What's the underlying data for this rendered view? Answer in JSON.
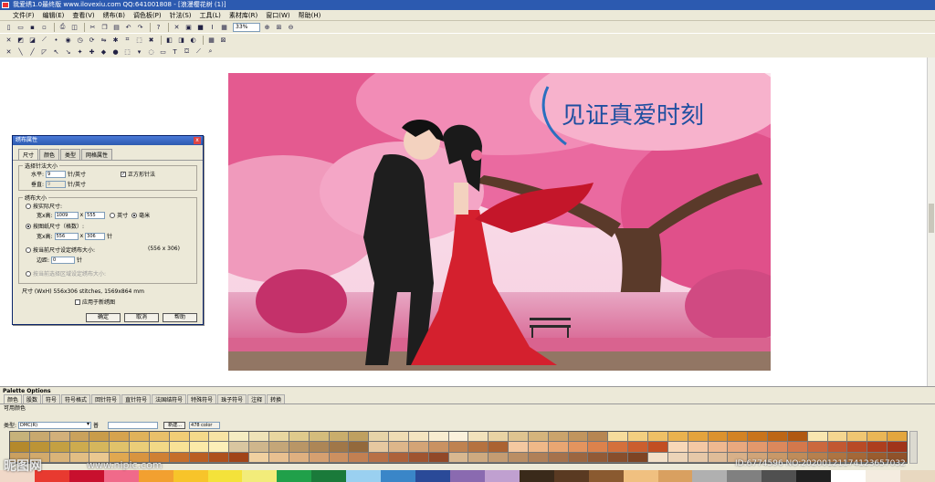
{
  "window_title": "我爱绣1.0最终版 www.ilovexiu.com QQ:641001808 - [浪漫樱花树 (1)]",
  "menu": [
    "文件(F)",
    "编辑(E)",
    "查看(V)",
    "绣布(B)",
    "调色板(P)",
    "针法(S)",
    "工具(L)",
    "素材库(R)",
    "窗口(W)",
    "帮助(H)"
  ],
  "toolbar": {
    "zoom_value": "33%"
  },
  "picture": {
    "title_text": "见证真爱时刻"
  },
  "dialog": {
    "title": "绣布属性",
    "close": "x",
    "tabs": [
      "尺寸",
      "颜色",
      "类型",
      "网格属性"
    ],
    "group_stitch": {
      "label": "选择针法大小",
      "horizontal_label": "水平:",
      "horizontal_value": "9",
      "horizontal_unit": "针/英寸",
      "square_label": "正方形针法",
      "square_checked": "✓",
      "vertical_label": "垂直:",
      "vertical_value": "9",
      "vertical_unit": "针/英寸"
    },
    "group_size": {
      "label": "绣布大小",
      "opt_actual": "按实际尺寸:",
      "wh_label": "宽x高:",
      "actual_w": "1009",
      "x_sep": "x",
      "actual_h": "555",
      "unit_inch": "英寸",
      "unit_mm": "毫米",
      "opt_pattern": "按图纸尺寸（格数）:",
      "pattern_w": "556",
      "pattern_h": "306",
      "pattern_unit": "针",
      "opt_current": "按当前尺寸设定绣布大小:",
      "current_dims": "(556 x 306)",
      "margin_label": "边距:",
      "margin_value": "0",
      "margin_unit": "针",
      "opt_selection": "按当前选择区域设定绣布大小:"
    },
    "size_line": "尺寸 (WxH) 556x306 stitches,  1569x864 mm",
    "apply_new": "应用于新绣图",
    "ok": "确定",
    "cancel": "取消",
    "help": "帮助"
  },
  "palette": {
    "title": "Palette Options",
    "tabs": [
      "颜色",
      "股数",
      "符号",
      "符号格式",
      "回针符号",
      "直针符号",
      "法国结符号",
      "特殊符号",
      "珠子符号",
      "注释",
      "转换"
    ],
    "sub": "可用颜色",
    "type_label": "类型:",
    "type_value": "DMC(R)",
    "extra": "普",
    "new_btn": "新建...",
    "count": "478 color",
    "swatches": [
      "#c6b27a",
      "#c9a96e",
      "#d2b07a",
      "#caa25c",
      "#c99c4a",
      "#d6a34e",
      "#e0b25a",
      "#e9c06a",
      "#f1cd76",
      "#f4d98a",
      "#f7e3a4",
      "#f5ecc2",
      "#efe3b8",
      "#e8d6a0",
      "#dfca8c",
      "#d4bc7c",
      "#c9ad6c",
      "#bfa060",
      "#e6d3a8",
      "#efdcb4",
      "#f4e4c0",
      "#f8ecd0",
      "#fbf1dc",
      "#f2e2bc",
      "#e9d3a4",
      "#dfc490",
      "#d5b47c",
      "#cba46c",
      "#c1955e",
      "#b78652",
      "#f6dc9c",
      "#f3cf80",
      "#efc066",
      "#eab24e",
      "#e4a33c",
      "#dc922e",
      "#d38324",
      "#c9741c",
      "#bd6616",
      "#b05812",
      "#f9e6b0",
      "#f5d690",
      "#f0c672",
      "#eab656",
      "#e3a63e",
      "#b4892c",
      "#bc9436",
      "#c4a042",
      "#cdab4e",
      "#d5b65c",
      "#e0c26a",
      "#eacd78",
      "#f2d886",
      "#f8e296",
      "#fbeaa8",
      "#fcefb8",
      "#d9c6a0",
      "#cfb68c",
      "#c4a678",
      "#b99666",
      "#ad8656",
      "#a07748",
      "#93693c",
      "#e6c8a0",
      "#ddb68a",
      "#d3a476",
      "#c99262",
      "#bf8250",
      "#b57240",
      "#ab6232",
      "#f4c8a0",
      "#efb888",
      "#e9a672",
      "#e3945e",
      "#dc824c",
      "#d4703c",
      "#cb5e2e",
      "#c24e22",
      "#f8d8b8",
      "#f4c8a4",
      "#efb890",
      "#e9a87e",
      "#e3986c",
      "#dc885c",
      "#d4784c",
      "#cb683e",
      "#c25832",
      "#b84a26",
      "#ad3e1e",
      "#a0341a",
      "#caa060",
      "#d2aa6c",
      "#dab478",
      "#e2be84",
      "#eac890",
      "#e0a850",
      "#d89440",
      "#cf8034",
      "#c56e2a",
      "#ba5e22",
      "#ae501c",
      "#a14418",
      "#f0d0a0",
      "#e8c090",
      "#dfb080",
      "#d6a070",
      "#cc9060",
      "#c28052",
      "#b87046",
      "#ad623a",
      "#9f5430",
      "#914828",
      "#d8b890",
      "#ceaa80",
      "#c49c72",
      "#ba8e64",
      "#b08058",
      "#a6724c",
      "#9c6640",
      "#925a36",
      "#884e2c",
      "#7e4424",
      "#f2e0c8",
      "#ecd4b8",
      "#e6c8a8",
      "#dfbc98",
      "#d8b088",
      "#d0a478",
      "#c89868",
      "#bf8c5a",
      "#b6804e",
      "#ad7442",
      "#a46838",
      "#9a5c2e",
      "#90522a",
      "#864826",
      "#7c4022"
    ],
    "bottom_strip": [
      "#f0d8c8",
      "#e83a30",
      "#c8102e",
      "#f06a8a",
      "#f2a030",
      "#f7c42a",
      "#f4e23a",
      "#f2ec7a",
      "#20a04a",
      "#1a7a3a",
      "#9ad0f0",
      "#3a86c8",
      "#2a4a98",
      "#8a6ab0",
      "#c0a0d0",
      "#3a2a1a",
      "#5a3a22",
      "#8a5a30",
      "#f0c080",
      "#d9a060",
      "#b0b0b0",
      "#808080",
      "#505050",
      "#202020",
      "#ffffff",
      "#f4ece0",
      "#e8d8c0"
    ]
  },
  "watermark": {
    "logo": "昵图网",
    "site": "www.nipic.com",
    "id": "ID:6774596 NO:20200121174123657032"
  }
}
